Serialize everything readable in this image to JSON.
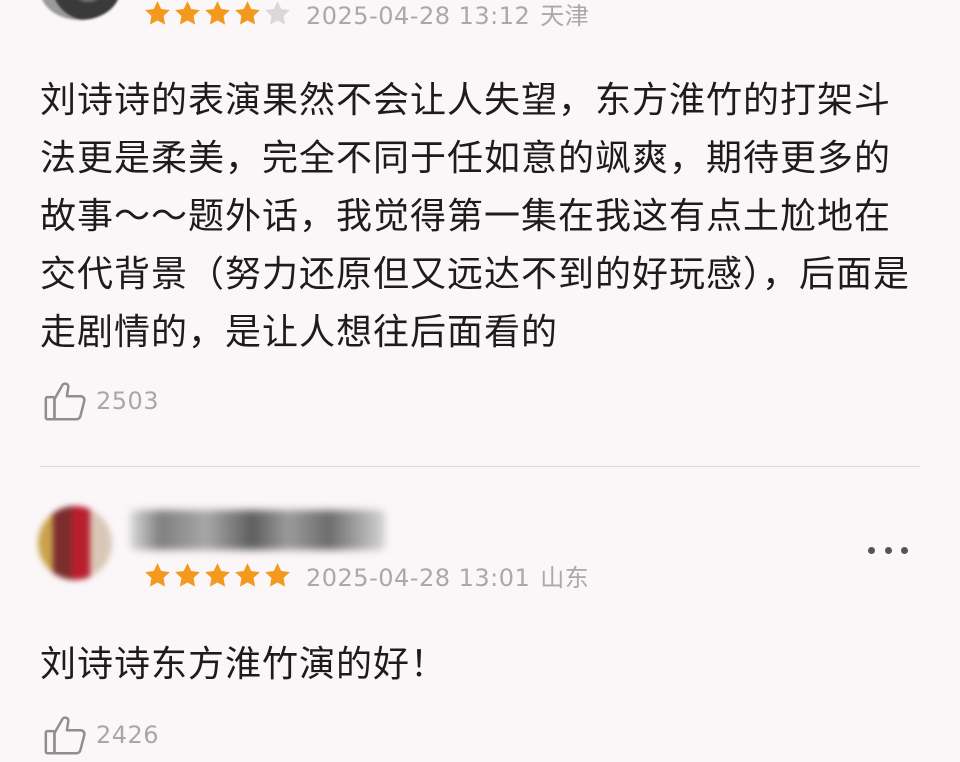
{
  "colors": {
    "background": "#fbf6f7",
    "star_filled": "#f39a1e",
    "star_empty": "#d9d9d9",
    "meta_text": "#a9a9a9",
    "comment_text": "#1c1c1c"
  },
  "reviews": [
    {
      "rating": 4,
      "max_rating": 5,
      "date": "2025-04-28 13:12",
      "location": "天津",
      "text": "刘诗诗的表演果然不会让人失望，东方淮竹的打架斗法更是柔美，完全不同于任如意的飒爽，期待更多的故事～～题外话，我觉得第一集在我这有点土尬地在交代背景（努力还原但又远达不到的好玩感），后面是走剧情的，是让人想往后面看的",
      "likes": "2503",
      "like_icon": "thumbs-up-icon"
    },
    {
      "rating": 5,
      "max_rating": 5,
      "date": "2025-04-28 13:01",
      "location": "山东",
      "text": "刘诗诗东方淮竹演的好！",
      "likes": "2426",
      "like_icon": "thumbs-up-icon",
      "more_icon": "more-dots-icon"
    }
  ]
}
